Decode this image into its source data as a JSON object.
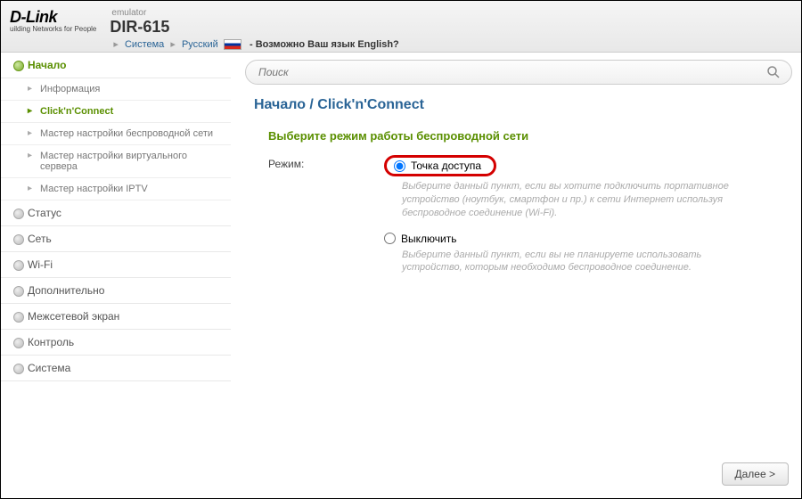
{
  "header": {
    "logo_main": "D-Link",
    "logo_tag": "uilding Networks for People",
    "emulator": "emulator",
    "model": "DIR-615",
    "bc_system": "Система",
    "bc_lang": "Русский",
    "bc_q": "- Возможно Ваш язык English?"
  },
  "sidebar": {
    "items": [
      {
        "label": "Начало",
        "expanded": true
      },
      {
        "label": "Статус"
      },
      {
        "label": "Сеть"
      },
      {
        "label": "Wi-Fi"
      },
      {
        "label": "Дополнительно"
      },
      {
        "label": "Межсетевой экран"
      },
      {
        "label": "Контроль"
      },
      {
        "label": "Система"
      }
    ],
    "sub": [
      {
        "label": "Информация"
      },
      {
        "label": "Click'n'Connect",
        "active": true
      },
      {
        "label": "Мастер настройки беспроводной сети"
      },
      {
        "label": "Мастер настройки виртуального сервера"
      },
      {
        "label": "Мастер настройки IPTV"
      }
    ]
  },
  "search": {
    "placeholder": "Поиск"
  },
  "content": {
    "breadcrumb": "Начало /  Click'n'Connect",
    "section_title": "Выберите режим работы беспроводной сети",
    "mode_label": "Режим:",
    "opt1": {
      "label": "Точка доступа",
      "desc": "Выберите данный пункт, если вы хотите подключить портативное устройство (ноутбук, смартфон и пр.) к сети Интернет используя беспроводное соединение (Wi-Fi)."
    },
    "opt2": {
      "label": "Выключить",
      "desc": "Выберите данный пункт, если вы не планируете использовать устройство, которым необходимо беспроводное соединение."
    },
    "next": "Далее >"
  }
}
